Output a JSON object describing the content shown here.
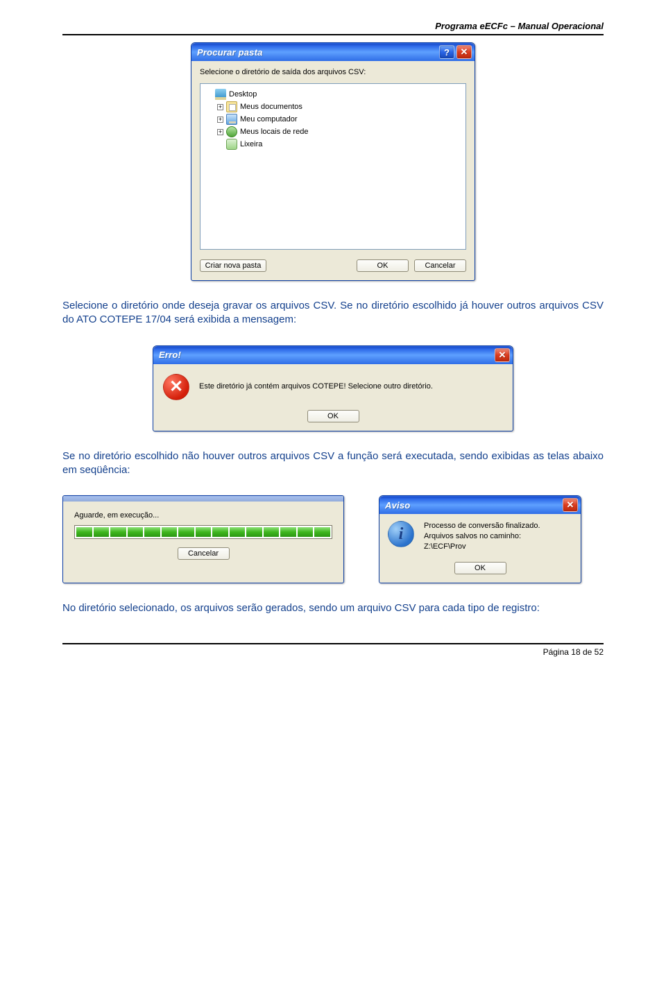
{
  "header": {
    "left": "Programa eECFc",
    "sep": " – ",
    "right": "Manual Operacional"
  },
  "browse": {
    "title": "Procurar pasta",
    "prompt": "Selecione o diretório de saída dos arquivos CSV:",
    "tree": {
      "desktop": "Desktop",
      "docs": "Meus documentos",
      "pc": "Meu computador",
      "net": "Meus locais de rede",
      "trash": "Lixeira"
    },
    "buttons": {
      "newfolder": "Criar nova pasta",
      "ok": "OK",
      "cancel": "Cancelar"
    }
  },
  "para1": "Selecione o diretório onde deseja gravar os arquivos CSV. Se no diretório escolhido já houver outros arquivos CSV do ATO COTEPE 17/04 será exibida a mensagem:",
  "error": {
    "title": "Erro!",
    "text": "Este diretório já contém arquivos COTEPE! Selecione outro diretório.",
    "ok": "OK"
  },
  "para2": "Se no diretório escolhido não houver outros arquivos CSV a função será executada, sendo exibidas as telas abaixo em seqüência:",
  "progress": {
    "label": "Aguarde, em execução...",
    "cancel": "Cancelar"
  },
  "aviso": {
    "title": "Aviso",
    "l1": "Processo de conversão finalizado.",
    "l2": "Arquivos salvos no caminho:",
    "l3": "Z:\\ECF\\Prov",
    "ok": "OK"
  },
  "para3": "No diretório selecionado, os arquivos serão gerados, sendo um arquivo CSV para cada tipo de registro:",
  "footer": "Página 18 de 52"
}
